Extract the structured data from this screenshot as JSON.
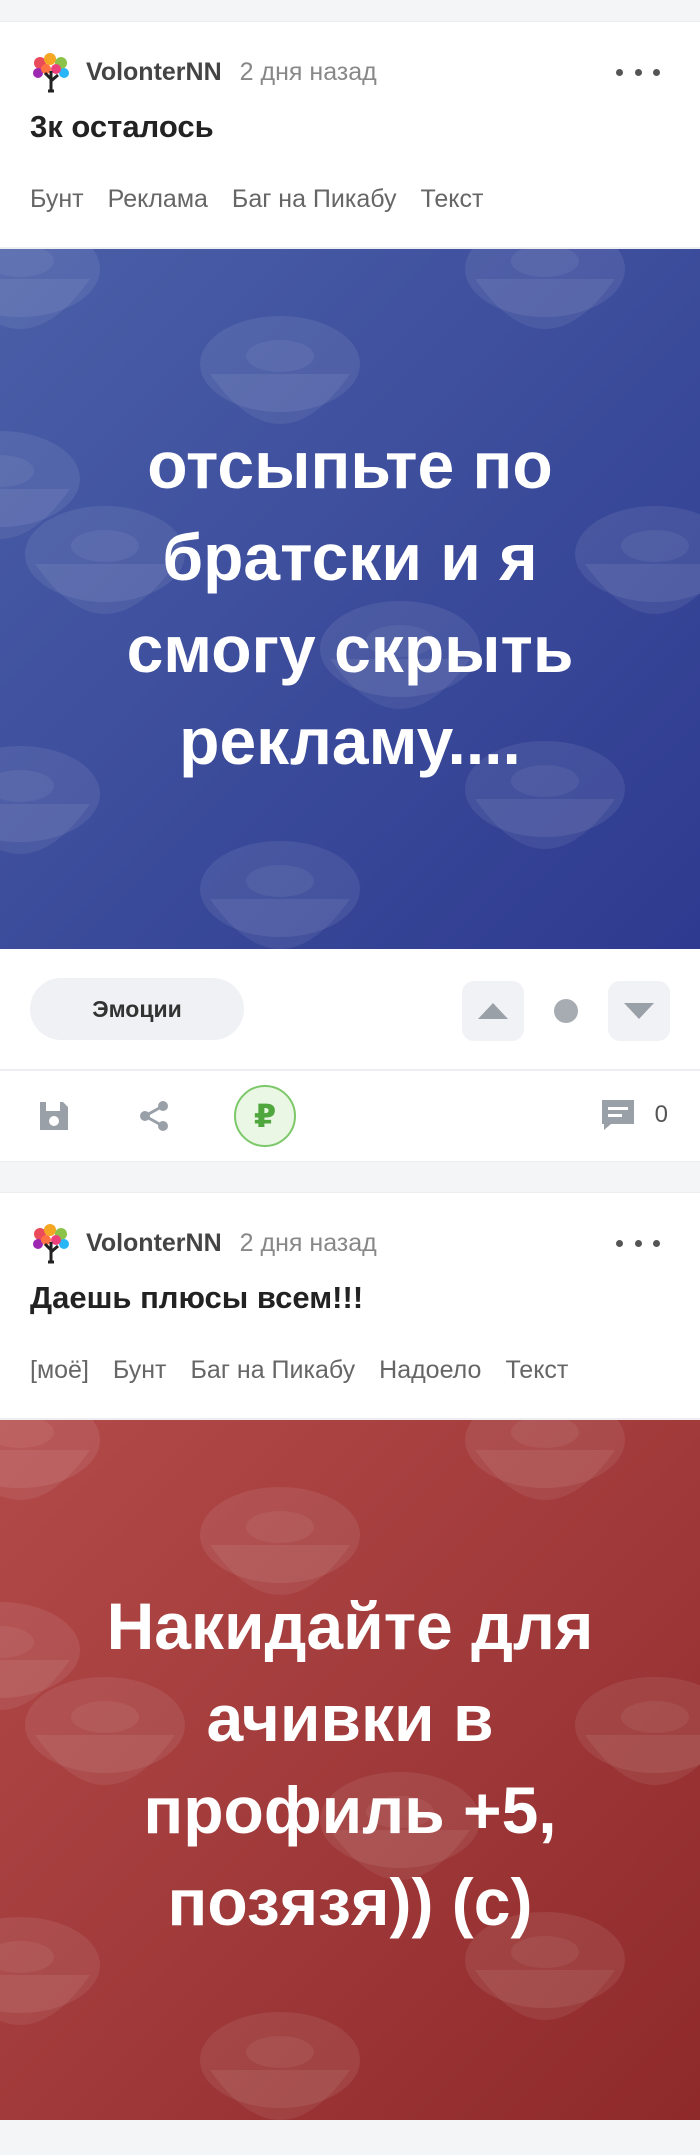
{
  "posts": [
    {
      "author": "VolonterNN",
      "time": "2 дня назад",
      "title": "3к осталось",
      "tags": [
        "Бунт",
        "Реклама",
        "Баг на Пикабу",
        "Текст"
      ],
      "image_lines": [
        "отсыпьте по",
        "братски и я",
        "смогу скрыть",
        "рекламу...."
      ],
      "emotions_label": "Эмоции",
      "comments_count": "0",
      "theme": {
        "from": "#4a5fa8",
        "to": "#2e3a8f"
      }
    },
    {
      "author": "VolonterNN",
      "time": "2 дня назад",
      "title": "Даешь плюсы всем!!!",
      "tags": [
        "[моё]",
        "Бунт",
        "Баг на Пикабу",
        "Надоело",
        "Текст"
      ],
      "image_lines": [
        "Накидайте для",
        "ачивки в",
        "профиль +5,",
        "позязя)) (с)"
      ],
      "theme": {
        "from": "#b34a4a",
        "to": "#8f2a2a"
      }
    }
  ],
  "icons": {
    "more": "more-dots-icon",
    "save": "save-icon",
    "share": "share-icon",
    "donate": "ruble-coin-icon",
    "comment": "comment-icon",
    "upvote": "upvote-icon",
    "downvote": "downvote-icon"
  },
  "donate_symbol": "₽"
}
